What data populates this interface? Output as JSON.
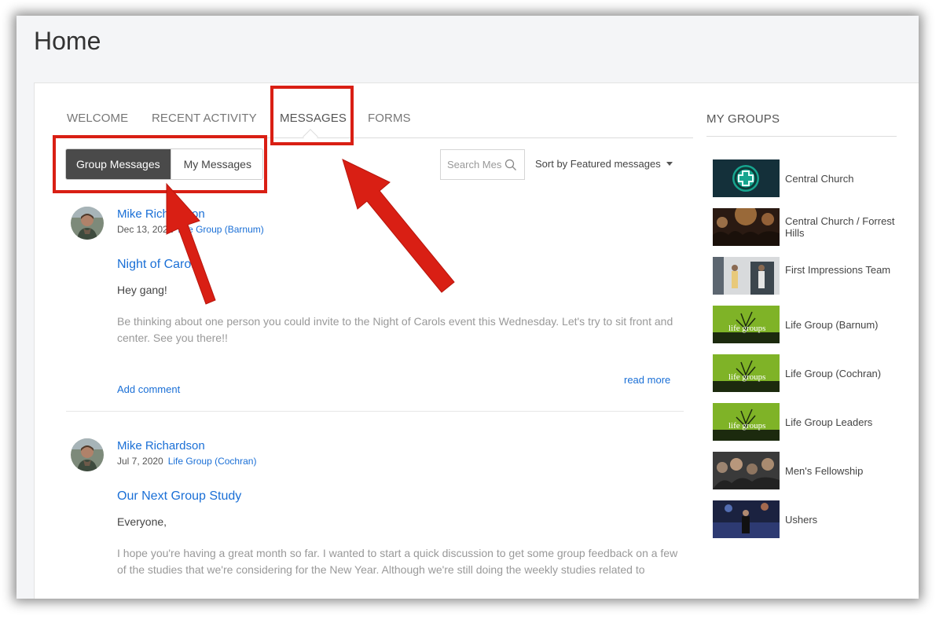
{
  "page": {
    "title": "Home"
  },
  "tabs": [
    {
      "label": "WELCOME",
      "active": false
    },
    {
      "label": "RECENT ACTIVITY",
      "active": false
    },
    {
      "label": "MESSAGES",
      "active": true
    },
    {
      "label": "FORMS",
      "active": false
    }
  ],
  "message_toggle": {
    "group_label": "Group Messages",
    "mine_label": "My Messages",
    "selected": "Group Messages"
  },
  "search": {
    "placeholder": "Search Messages"
  },
  "sort": {
    "label": "Sort by Featured messages"
  },
  "posts": [
    {
      "author": "Mike Richardson",
      "date": "Dec 13, 2022",
      "group": "Life Group (Barnum)",
      "title": "Night of Carols",
      "greeting": "Hey gang!",
      "body": "Be thinking about one person you could invite to the Night of Carols event this Wednesday. Let's try to sit front and center. See you there!!",
      "read_more": "read more",
      "add_comment": "Add comment"
    },
    {
      "author": "Mike Richardson",
      "date": "Jul 7, 2020",
      "group": "Life Group (Cochran)",
      "title": "Our Next Group Study",
      "greeting": "Everyone,",
      "body": "I hope you're having a great month so far.  I wanted to start a quick discussion to get some group feedback on a few of the studies that we're considering for the New Year.  Although we're still doing the weekly studies related to"
    }
  ],
  "sidebar": {
    "heading": "MY GROUPS",
    "groups": [
      {
        "name": "Central Church"
      },
      {
        "name": "Central Church / Forrest Hills"
      },
      {
        "name": "First Impressions Team"
      },
      {
        "name": "Life Group (Barnum)"
      },
      {
        "name": "Life Group (Cochran)"
      },
      {
        "name": "Life Group Leaders"
      },
      {
        "name": "Men's Fellowship"
      },
      {
        "name": "Ushers"
      }
    ]
  },
  "colors": {
    "link": "#1a6fd6",
    "annotation": "#d91f14",
    "toggle_active": "#4a4a4a"
  },
  "icons": [
    "search-icon",
    "dropdown-caret-icon",
    "central-church-logo-icon"
  ]
}
